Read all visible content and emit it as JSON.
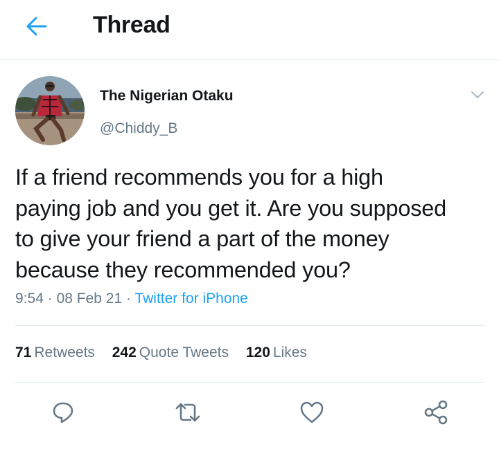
{
  "header": {
    "title": "Thread",
    "back_icon": "back-arrow-icon",
    "accent_color": "#1da1f2"
  },
  "tweet": {
    "author_name": "The Nigerian Otaku",
    "author_handle": "@Chiddy_B",
    "text": "If a friend recommends you for a high\npaying job and you get it. Are you supposed\nto give your friend a part of the money\nbecause they recommended you?",
    "time": "9:54",
    "date": "08 Feb 21",
    "source": "Twitter for iPhone",
    "separator": "·"
  },
  "stats": {
    "retweets_count": "71",
    "retweets_label": "Retweets",
    "quotes_count": "242",
    "quotes_label": "Quote Tweets",
    "likes_count": "120",
    "likes_label": "Likes"
  },
  "actions": [
    {
      "icon": "reply-icon"
    },
    {
      "icon": "retweet-icon"
    },
    {
      "icon": "like-icon"
    },
    {
      "icon": "share-icon"
    }
  ]
}
